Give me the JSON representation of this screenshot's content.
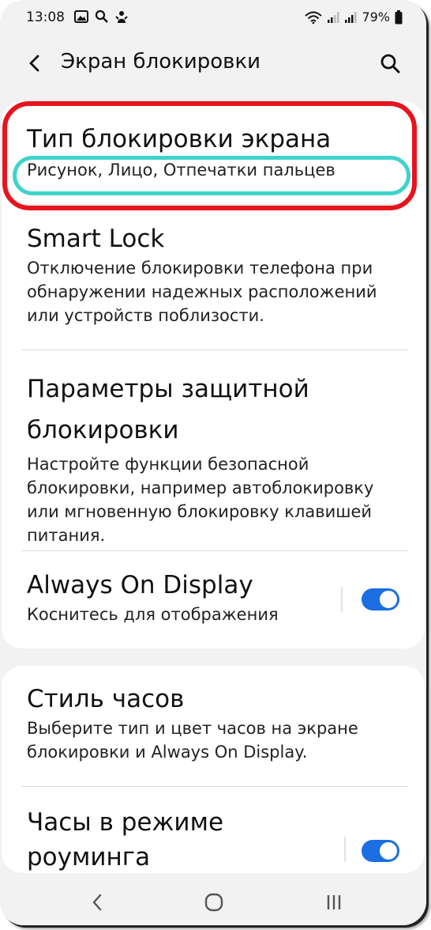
{
  "status_bar": {
    "time": "13:08",
    "battery": "79%",
    "icons": [
      "gallery-icon",
      "search-notification-icon",
      "bixby-icon",
      "wifi-icon",
      "signal-icon",
      "signal-icon-2",
      "battery-icon"
    ]
  },
  "header": {
    "title": "Экран блокировки",
    "back_icon": "chevron-left-icon",
    "search_icon": "search-icon"
  },
  "settings": {
    "lock_type": {
      "title": "Тип блокировки экрана",
      "subtitle": "Рисунок, Лицо, Отпечатки пальцев"
    },
    "smart_lock": {
      "title": "Smart Lock",
      "subtitle": "Отключение блокировки телефона при обнаружении надежных расположений или устройств поблизости."
    },
    "secure_lock": {
      "title": "Параметры защитной блокировки",
      "subtitle": "Настройте функции безопасной блокировки, например автоблокировку или мгновенную блокировку клавишей питания."
    },
    "always_on": {
      "title": "Always On Display",
      "subtitle": "Коснитесь для отображения",
      "enabled": true
    },
    "clock_style": {
      "title": "Стиль часов",
      "subtitle": "Выберите тип и цвет часов на экране блокировки и Always On Display."
    },
    "roaming_clock": {
      "title": "Часы в режиме роуминга",
      "enabled": true
    }
  },
  "annotations": {
    "red_highlight_color": "#e6141c",
    "cyan_highlight_color": "#3fd3cc"
  },
  "colors": {
    "accent": "#1b6fe2",
    "background": "#f2f2f2",
    "card": "#ffffff"
  },
  "nav_bar": {
    "back": "nav-back-icon",
    "home": "nav-home-icon",
    "recents": "nav-recents-icon"
  }
}
